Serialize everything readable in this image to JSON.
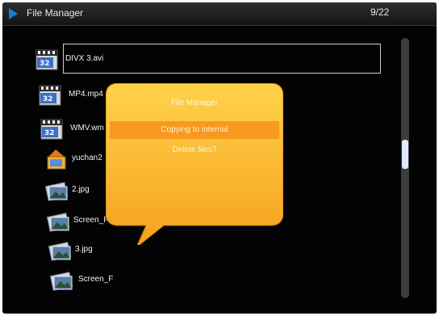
{
  "header": {
    "title": "File Manager",
    "page_indicator": "9/22"
  },
  "files": [
    {
      "name": "DIVX 3.avi",
      "icon": "video-file-icon",
      "selected": true
    },
    {
      "name": "MP4.mp4",
      "icon": "video-file-icon"
    },
    {
      "name": "WMV.wm",
      "icon": "video-file-icon"
    },
    {
      "name": "yuchan2",
      "icon": "folder-icon"
    },
    {
      "name": "2.jpg",
      "icon": "image-file-icon"
    },
    {
      "name": "Screen_F",
      "icon": "image-file-icon"
    },
    {
      "name": "3.jpg",
      "icon": "image-file-icon"
    },
    {
      "name": "Screen_F",
      "icon": "image-file-icon"
    }
  ],
  "dialog": {
    "title": "File Manager",
    "options": [
      "Copying to internal",
      "Delete files?"
    ],
    "highlighted_option": "Copying to internal"
  },
  "colors": {
    "accent": "#f7991e",
    "dialog_top": "#ffd24a",
    "dialog_bottom": "#f5a11e",
    "title_arrow": "#1a7be0"
  }
}
